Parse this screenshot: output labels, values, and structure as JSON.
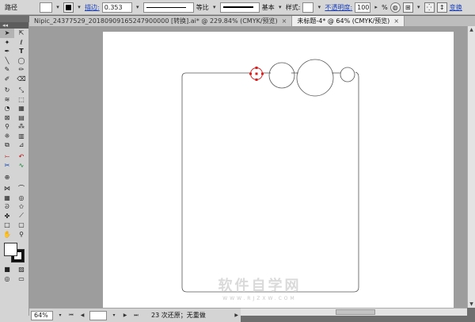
{
  "control_bar": {
    "tool_name": "路径",
    "stroke_label": "描边:",
    "stroke_weight": "0.353",
    "profile_label": "等比",
    "brush_label": "基本",
    "style_label": "样式:",
    "opacity_label": "不透明度:",
    "opacity_value": "100",
    "opacity_unit": "%",
    "transform_label": "变换"
  },
  "tabs": [
    {
      "label": "Nipic_24377529_20180909165247900000 [转换].ai* @ 229.84% (CMYK/预览)",
      "close": "×"
    },
    {
      "label": "未标题-4* @ 64% (CMYK/预览)",
      "close": "×"
    }
  ],
  "tool_panel": {
    "header": "◂◂"
  },
  "status_bar": {
    "zoom": "64%",
    "undo_status": "23 次还原；无重做"
  },
  "watermark": {
    "title": "软件自学网",
    "url": "WWW.RJZXW.COM"
  },
  "icons": {
    "selection": "selection-tool-icon",
    "direct_selection": "direct-selection-tool-icon",
    "pen": "pen-tool-icon",
    "type": "type-tool-icon"
  },
  "colors": {
    "artwork_stroke": "#555555",
    "selected_anchor": "#d62020",
    "link_text": "#1a3fb8"
  }
}
